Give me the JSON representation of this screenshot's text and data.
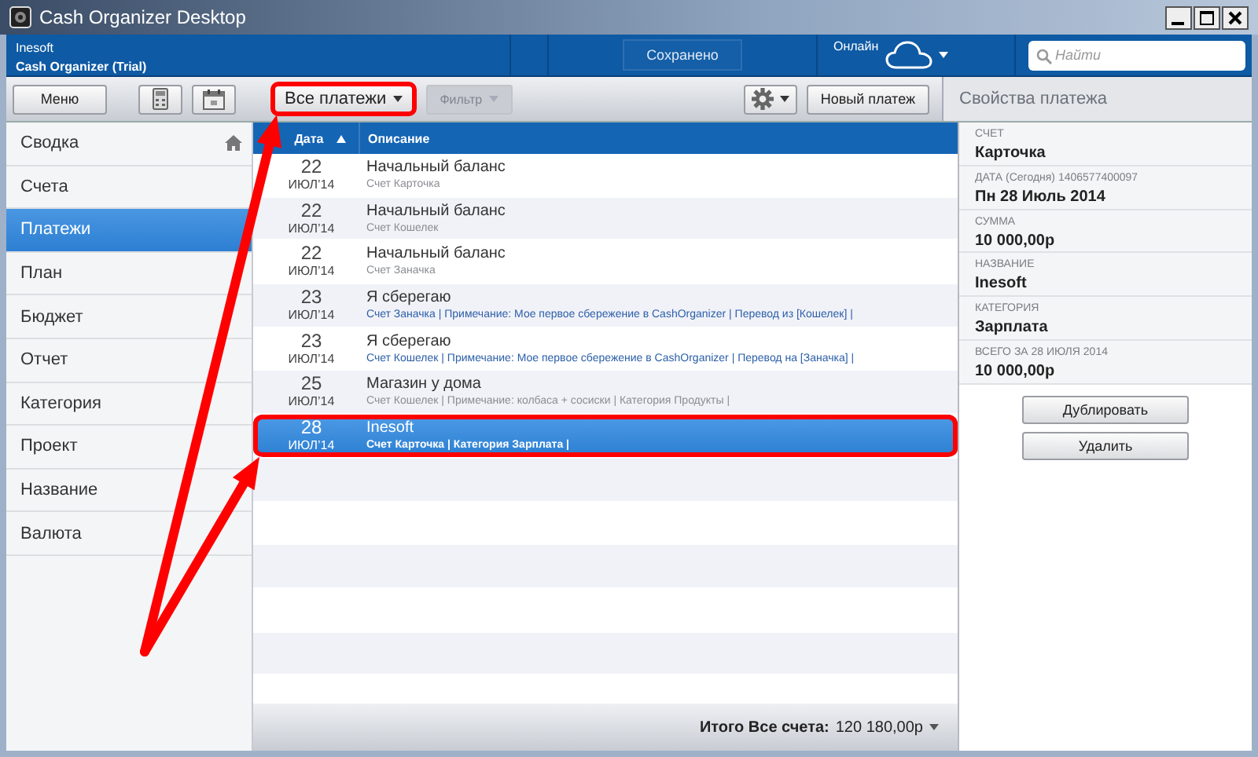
{
  "window": {
    "title": "Cash Organizer Desktop"
  },
  "header": {
    "company": "Inesoft",
    "product": "Cash Organizer (Trial)",
    "save_status": "Сохранено",
    "online_label": "Онлайн",
    "search": {
      "placeholder": "Найти"
    }
  },
  "toolbar": {
    "menu": "Меню",
    "view_dropdown": {
      "label": "Все платежи",
      "highlighted": true
    },
    "filter": {
      "label": "Фильтр",
      "disabled": true
    },
    "new_payment": "Новый платеж",
    "panel_title": "Свойства платежа"
  },
  "sidebar": {
    "items": [
      {
        "label": "Сводка",
        "selected": false,
        "kind": "home"
      },
      {
        "label": "Счета",
        "selected": false
      },
      {
        "label": "Платежи",
        "selected": true
      },
      {
        "label": "План",
        "selected": false
      },
      {
        "label": "Бюджет",
        "selected": false
      },
      {
        "label": "Отчет",
        "selected": false
      },
      {
        "label": "Категория",
        "selected": false
      },
      {
        "label": "Проект",
        "selected": false
      },
      {
        "label": "Название",
        "selected": false
      },
      {
        "label": "Валюта",
        "selected": false
      }
    ]
  },
  "table": {
    "columns": [
      {
        "label": "Дата",
        "sorted": true
      },
      {
        "label": "Описание"
      }
    ],
    "rows": [
      {
        "day": "22",
        "month": "ИЮЛ’14",
        "title": "Начальный баланс",
        "details": "Счет Карточка",
        "kind": "plain",
        "selected": false,
        "highlighted": false
      },
      {
        "day": "22",
        "month": "ИЮЛ’14",
        "title": "Начальный баланс",
        "details": "Счет Кошелек",
        "kind": "plain",
        "selected": false,
        "highlighted": false
      },
      {
        "day": "22",
        "month": "ИЮЛ’14",
        "title": "Начальный баланс",
        "details": "Счет Заначка",
        "kind": "plain",
        "selected": false,
        "highlighted": false
      },
      {
        "day": "23",
        "month": "ИЮЛ’14",
        "title": "Я сберегаю",
        "details": "Счет Заначка | Примечание: Мое первое сбережение в CashOrganizer | Перевод из [Кошелек] |",
        "kind": "link",
        "selected": false,
        "highlighted": false
      },
      {
        "day": "23",
        "month": "ИЮЛ’14",
        "title": "Я сберегаю",
        "details": "Счет Кошелек | Примечание: Мое первое сбережение в CashOrganizer | Перевод на [Заначка] |",
        "kind": "link",
        "selected": false,
        "highlighted": false
      },
      {
        "day": "25",
        "month": "ИЮЛ’14",
        "title": "Магазин у дома",
        "details": "Счет Кошелек | Примечание: колбаса + сосиски | Категория Продукты |",
        "kind": "plain",
        "selected": false,
        "highlighted": false
      },
      {
        "day": "28",
        "month": "ИЮЛ’14",
        "title": "Inesoft",
        "details": "Счет Карточка | Категория Зарплата |",
        "kind": "plain",
        "selected": true,
        "highlighted": true
      }
    ]
  },
  "footer": {
    "total_label": "Итого Все счета:",
    "total_value": "120 180,00р"
  },
  "properties": {
    "fields": [
      {
        "label": "СЧЕТ",
        "value": "Карточка"
      },
      {
        "label": "ДАТА (Сегодня) 1406577400097",
        "value": "Пн 28 Июль 2014"
      },
      {
        "label": "СУММА",
        "value": "10 000,00р"
      },
      {
        "label": "НАЗВАНИЕ",
        "value": "Inesoft"
      },
      {
        "label": "КАТЕГОРИЯ",
        "value": "Зарплата"
      },
      {
        "label": "ВСЕГО ЗА 28 ИЮЛЯ 2014",
        "value": "10 000,00р"
      }
    ],
    "buttons": [
      "Дублировать",
      "Удалить"
    ]
  }
}
